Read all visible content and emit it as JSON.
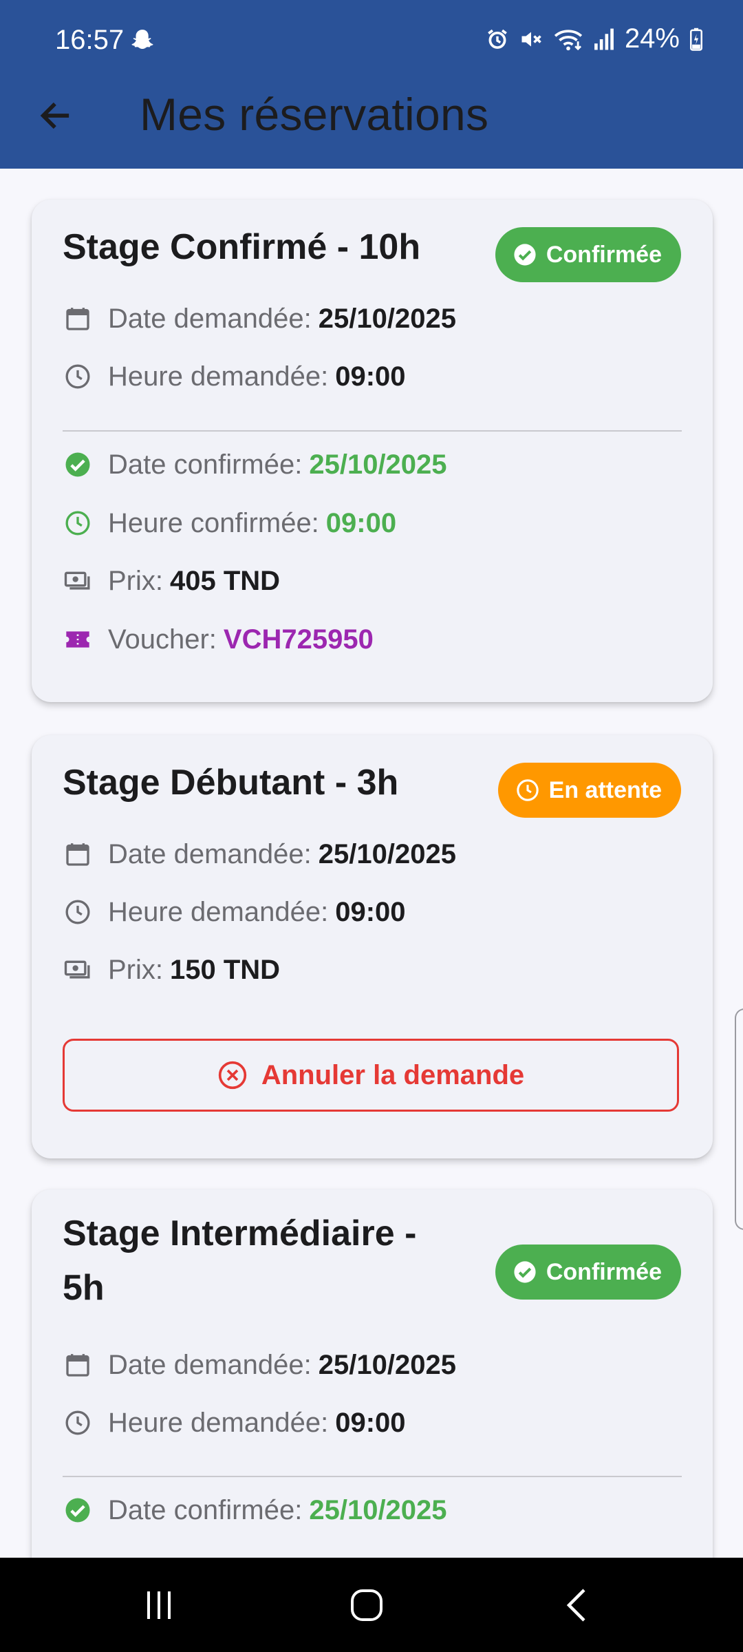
{
  "status_bar": {
    "time": "16:57",
    "battery": "24%",
    "icons": [
      "snapchat-ghost-icon",
      "alarm-icon",
      "mute-icon",
      "wifi-icon",
      "signal-icon",
      "battery-charging-icon"
    ]
  },
  "app_bar": {
    "title": "Mes réservations",
    "back_icon": "arrow-back-icon",
    "color": "#2A5298"
  },
  "colors": {
    "confirmed": "#4CAF50",
    "pending": "#FF9800",
    "voucher": "#9C27B0",
    "danger": "#E53935"
  },
  "reservations": [
    {
      "title": "Stage Confirmé - 10h",
      "status": "Confirmée",
      "rows": [
        {
          "label": "Date demandée:",
          "value": "25/10/2025"
        },
        {
          "label": "Heure demandée:",
          "value": "09:00"
        },
        {
          "label": "Date confirmée:",
          "value": "25/10/2025"
        },
        {
          "label": "Heure confirmée:",
          "value": "09:00"
        },
        {
          "label": "Prix:",
          "value": "405 TND"
        },
        {
          "label": "Voucher:",
          "value": "VCH725950"
        }
      ]
    },
    {
      "title": "Stage Débutant - 3h",
      "status": "En attente",
      "rows": [
        {
          "label": "Date demandée:",
          "value": "25/10/2025"
        },
        {
          "label": "Heure demandée:",
          "value": "09:00"
        },
        {
          "label": "Prix:",
          "value": "150 TND"
        }
      ],
      "cancel_label": "Annuler la demande"
    },
    {
      "title_line1": "Stage Intermédiaire -",
      "title_line2": "5h",
      "status": "Confirmée",
      "rows": [
        {
          "label": "Date demandée:",
          "value": "25/10/2025"
        },
        {
          "label": "Heure demandée:",
          "value": "09:00"
        },
        {
          "label": "Date confirmée:",
          "value": "25/10/2025"
        }
      ]
    }
  ],
  "nav_bar": {
    "buttons": [
      "recents-icon",
      "home-icon",
      "back-nav-icon"
    ]
  }
}
